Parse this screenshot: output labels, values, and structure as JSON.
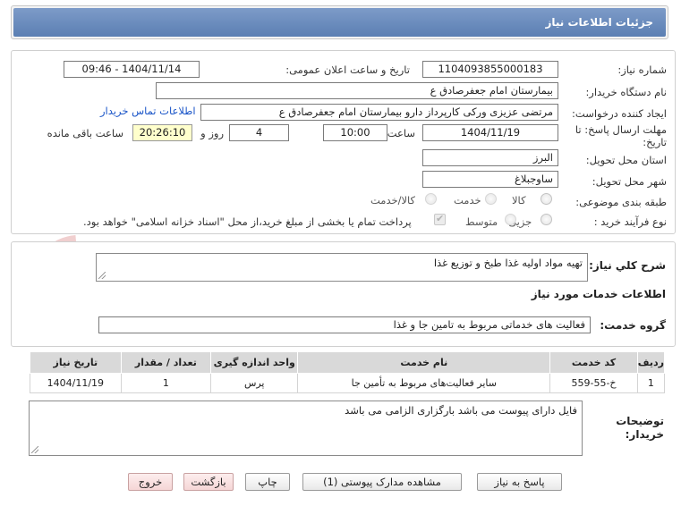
{
  "title": "جزئیات اطلاعات نیاز",
  "colors": {
    "title_bar": "#6a8cc0",
    "link": "#1a55c8",
    "remaining_bg": "#ffffcc",
    "watermark": "#e6a7a7"
  },
  "watermark_text": "AriaTender.net",
  "fields": {
    "need_number_label": "شماره نیاز:",
    "need_number": "1104093855000183",
    "announce_label": "تاریخ و ساعت اعلان عمومی:",
    "announce_value": "1404/11/14 - 09:46",
    "buyer_org_label": "نام دستگاه خریدار:",
    "buyer_org": "بیمارستان امام جعفرصادق ع",
    "creator_label": "ایجاد کننده درخواست:",
    "creator": "مرتضی عزیزی ورکی کارپرداز دارو بیمارستان امام جعفرصادق ع",
    "contact_link": "اطلاعات تماس خریدار",
    "deadline_label_1": "مهلت ارسال پاسخ: تا",
    "deadline_label_2": "تاریخ:",
    "deadline_date": "1404/11/19",
    "time_label": "ساعت",
    "deadline_time": "10:00",
    "days_value": "4",
    "days_label": "روز و",
    "remaining_time": "20:26:10",
    "remaining_label": "ساعت باقی مانده",
    "province_label": "استان محل تحویل:",
    "province": "البرز",
    "city_label": "شهر محل تحویل:",
    "city": "ساوجبلاغ",
    "category_label": "طبقه بندی موضوعی:",
    "category_options": [
      "کالا",
      "خدمت",
      "کالا/خدمت"
    ],
    "process_label": "نوع فرآیند خرید :",
    "process_options": [
      "جزیی",
      "متوسط"
    ],
    "payment_note": "پرداخت تمام یا بخشی از مبلغ خرید،از محل \"اسناد خزانه اسلامی\" خواهد بود."
  },
  "summary": {
    "label": "شرح کلي نياز:",
    "value": "تهیه مواد اولیه غذا طبخ و توزیع غذا"
  },
  "services": {
    "section_title": "اطلاعات خدمات مورد نیاز",
    "group_label": "گروه خدمت:",
    "group_value": "فعالیت های خدماتی مربوط به تامین جا و غذا",
    "columns": [
      "ردیف",
      "کد خدمت",
      "نام خدمت",
      "واحد اندازه گیری",
      "تعداد / مقدار",
      "تاریخ نیاز"
    ],
    "rows": [
      [
        "1",
        "خ-55-559",
        "سایر فعالیت‌های مربوط به تأمین جا",
        "پرس",
        "1",
        "1404/11/19"
      ]
    ]
  },
  "notes": {
    "label_1": "توضیحات",
    "label_2": "خریدار:",
    "value": "فایل دارای پیوست می باشد بارگزاری الزامی می باشد"
  },
  "buttons": {
    "reply": "پاسخ به نیاز",
    "attachments": "مشاهده مدارک پیوستی (1)",
    "print": "چاپ",
    "back": "بازگشت",
    "exit": "خروج"
  }
}
